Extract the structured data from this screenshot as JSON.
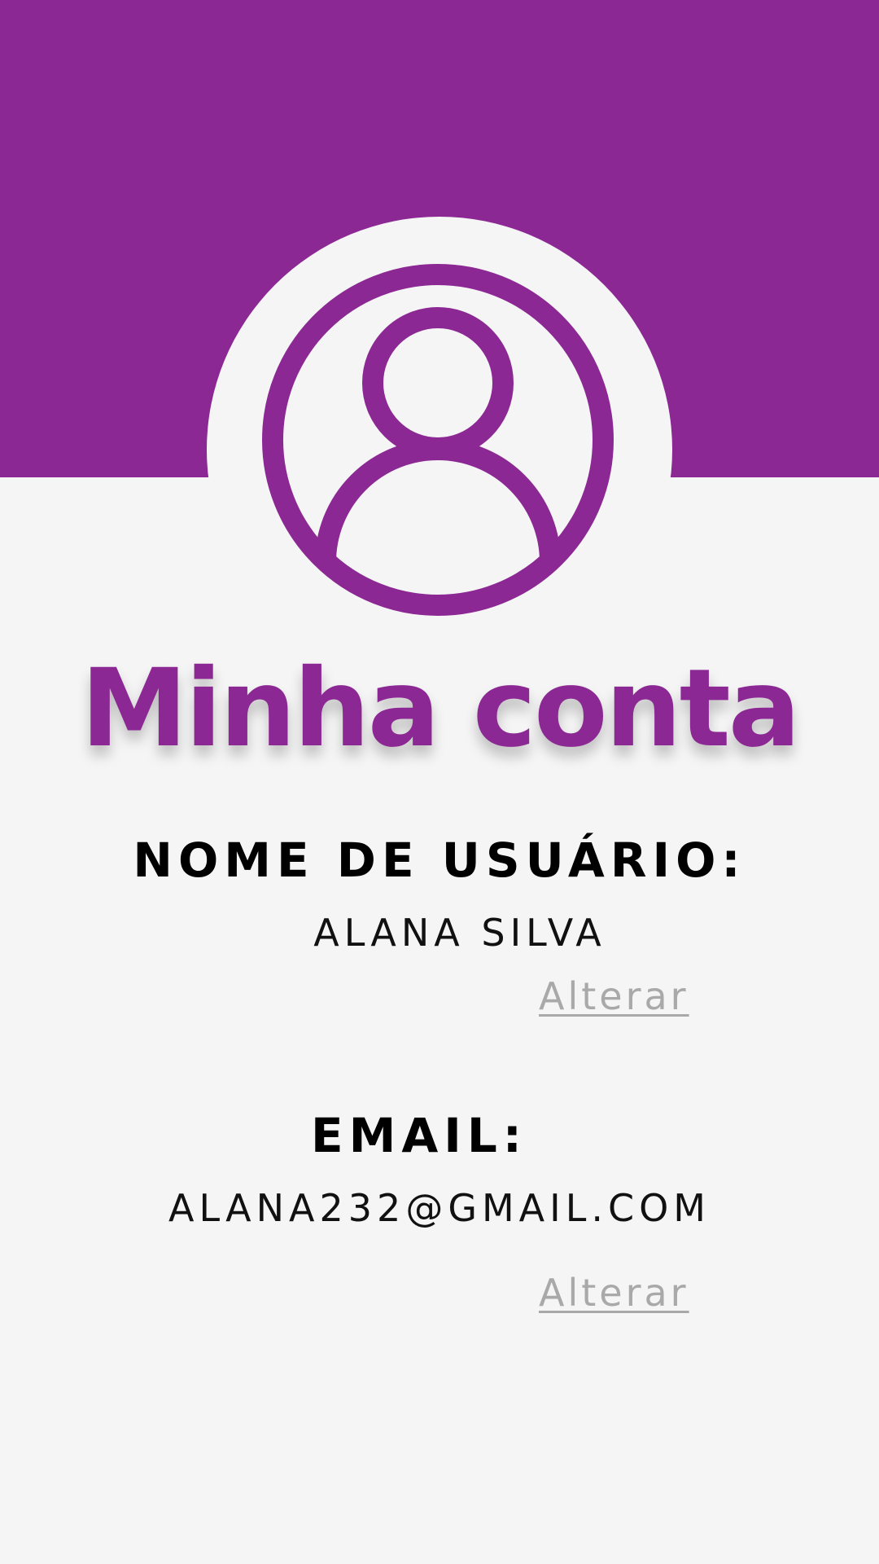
{
  "colors": {
    "accent": "#8c2894",
    "background": "#f5f5f5",
    "link": "#a9a9a9",
    "text": "#000000"
  },
  "header": {
    "avatar_icon": "user-circle-icon"
  },
  "page": {
    "title": "Minha conta"
  },
  "username": {
    "label": "NOME DE USUÁRIO:",
    "value": "ALANA SILVA",
    "action_label": "Alterar"
  },
  "email": {
    "label": "EMAIL:",
    "value": "ALANA232@GMAIL.COM",
    "action_label": "Alterar"
  }
}
